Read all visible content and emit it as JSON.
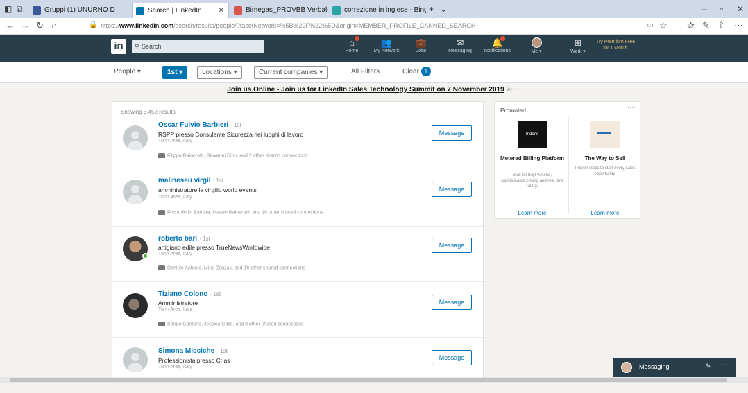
{
  "browser": {
    "tabs": [
      {
        "label": "Gruppi (1) UNURNO D",
        "color": "#3b5998"
      },
      {
        "label": "Search | LinkedIn",
        "color": "#0073b1"
      },
      {
        "label": "Bimegas_PROVBB Verbale Av",
        "color": "#d9534f"
      },
      {
        "label": "correzione in inglese - Bing",
        "color": "#2aa5a5"
      }
    ],
    "url_host": "www.linkedin.com",
    "url_rest": "/search/results/people/?facetNetwork=%5B%22F%22%5D&origin=MEMBER_PROFILE_CANNED_SEARCH"
  },
  "header": {
    "logo": "in",
    "search_placeholder": "Search",
    "nav": [
      {
        "icon": "home-icon",
        "glyph": "⌂",
        "label": "Home",
        "badge": true
      },
      {
        "icon": "network-icon",
        "glyph": "👥",
        "label": "My Network",
        "badge": false
      },
      {
        "icon": "jobs-icon",
        "glyph": "💼",
        "label": "Jobs",
        "badge": false
      },
      {
        "icon": "messaging-icon",
        "glyph": "✉",
        "label": "Messaging",
        "badge": false
      },
      {
        "icon": "notifications-icon",
        "glyph": "🔔",
        "label": "Notifications",
        "badge": true
      }
    ],
    "me_label": "Me ▾",
    "work_label": "Work ▾",
    "premium_text": "Try Premium Free for 1 Month"
  },
  "filters": {
    "people": "People ▾",
    "degree": "1st ▾",
    "locations": "Locations ▾",
    "companies": "Current companies ▾",
    "all": "All Filters",
    "clear": "Clear",
    "clear_count": "1"
  },
  "promo": {
    "text": "Join us Online - Join us for LinkedIn Sales Technology Summit on 7 November 2019",
    "ad": "Ad  ···"
  },
  "results": {
    "count": "Showing 3,452 results",
    "message_label": "Message",
    "people": [
      {
        "name": "Oscar Fulvio Barbieri",
        "degree": "· 1st",
        "title": "RSPP presso Consulente Sicurezza nei luoghi di lavoro",
        "location": "Turin Area, Italy",
        "shared": "Filippo Rainerotti, Giovanni Dino, and 2 other shared connections",
        "avatar": "placeholder"
      },
      {
        "name": "malineseu virgil",
        "degree": "· 1st",
        "title": "amministratore la virgilio world events",
        "location": "Turin Area, Italy",
        "shared": "Riccardo Di Battista, Matteo Rainerotti, and 16 other shared connections",
        "avatar": "placeholder"
      },
      {
        "name": "roberto bari",
        "degree": "· 1st",
        "title": "artigiano edile presso TrueNewsWorldwide",
        "location": "Turin Area, Italy",
        "shared": "Daniele Antonio, Mina Zonzak, and 16 other shared connections",
        "avatar": "photo1"
      },
      {
        "name": "Tiziano Colono",
        "degree": "· 1st",
        "title": "Amministratore",
        "location": "Turin Area, Italy",
        "shared": "Sergio Gaetano, Jessica Gallo, and 3 other shared connections",
        "avatar": "photo2"
      },
      {
        "name": "Simona Micciche",
        "degree": "· 1st",
        "title": "Professionista presso Crias",
        "location": "Turin Area, Italy",
        "shared": "",
        "avatar": "placeholder"
      }
    ]
  },
  "promoted": {
    "heading": "Promoted",
    "more": "···",
    "ads": [
      {
        "title": "Metered Billing Platform",
        "desc": "Built for high volume, sophisticated pricing and real time rating.",
        "cta": "Learn more",
        "logo_text": "tridens"
      },
      {
        "title": "The Way to Sell",
        "desc": "Proven steps to start every sales opportunity.",
        "cta": "Learn more",
        "logo_text": ""
      }
    ]
  },
  "messaging": {
    "label": "Messaging",
    "compose_glyph": "✎",
    "more_glyph": "···"
  }
}
